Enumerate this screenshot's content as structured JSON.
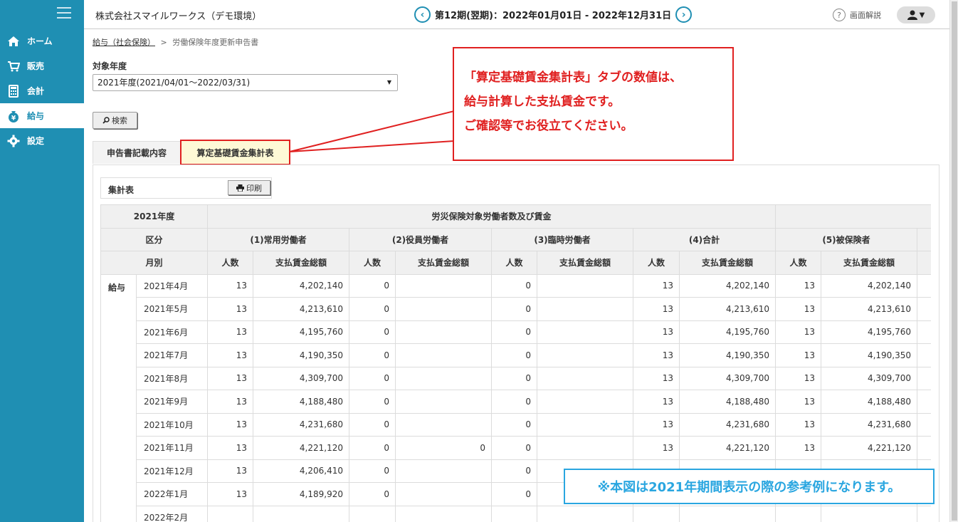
{
  "sidebar": {
    "items": [
      {
        "label": "ホーム",
        "icon": "home-icon"
      },
      {
        "label": "販売",
        "icon": "cart-icon"
      },
      {
        "label": "会計",
        "icon": "calculator-icon"
      },
      {
        "label": "給与",
        "icon": "money-bag-icon",
        "active": true
      },
      {
        "label": "設定",
        "icon": "gear-icon"
      }
    ]
  },
  "header": {
    "company": "株式会社スマイルワークス（デモ環境）",
    "period": "第12期(翌期)：2022年01月01日 - 2022年12月31日",
    "help_label": "画面解説"
  },
  "breadcrumb": {
    "parent": "給与（社会保険）",
    "separator": ">",
    "current": "労働保険年度更新申告書"
  },
  "form": {
    "year_label": "対象年度",
    "year_value": "2021年度(2021/04/01～2022/03/31)",
    "search_label": "検索"
  },
  "tabs": [
    {
      "label": "申告書記載内容"
    },
    {
      "label": "算定基礎賃金集計表",
      "active": true
    }
  ],
  "summary": {
    "title": "集計表",
    "print_label": "印刷"
  },
  "table": {
    "year": "2021年度",
    "group_header": "労災保険対象労働者数及び賃金",
    "kubun": "区分",
    "month_label": "月別",
    "columns": [
      "(1)常用労働者",
      "(2)役員労働者",
      "(3)臨時労働者",
      "(4)合計",
      "(5)被保険者"
    ],
    "sub_count": "人数",
    "sub_amount": "支払賃金総額",
    "category": "給与",
    "rows": [
      {
        "month": "2021年4月",
        "c1": "13",
        "a1": "4,202,140",
        "c2": "0",
        "a2": "",
        "c3": "0",
        "a3": "",
        "c4": "13",
        "a4": "4,202,140",
        "c5": "13",
        "a5": "4,202,140"
      },
      {
        "month": "2021年5月",
        "c1": "13",
        "a1": "4,213,610",
        "c2": "0",
        "a2": "",
        "c3": "0",
        "a3": "",
        "c4": "13",
        "a4": "4,213,610",
        "c5": "13",
        "a5": "4,213,610"
      },
      {
        "month": "2021年6月",
        "c1": "13",
        "a1": "4,195,760",
        "c2": "0",
        "a2": "",
        "c3": "0",
        "a3": "",
        "c4": "13",
        "a4": "4,195,760",
        "c5": "13",
        "a5": "4,195,760"
      },
      {
        "month": "2021年7月",
        "c1": "13",
        "a1": "4,190,350",
        "c2": "0",
        "a2": "",
        "c3": "0",
        "a3": "",
        "c4": "13",
        "a4": "4,190,350",
        "c5": "13",
        "a5": "4,190,350"
      },
      {
        "month": "2021年8月",
        "c1": "13",
        "a1": "4,309,700",
        "c2": "0",
        "a2": "",
        "c3": "0",
        "a3": "",
        "c4": "13",
        "a4": "4,309,700",
        "c5": "13",
        "a5": "4,309,700"
      },
      {
        "month": "2021年9月",
        "c1": "13",
        "a1": "4,188,480",
        "c2": "0",
        "a2": "",
        "c3": "0",
        "a3": "",
        "c4": "13",
        "a4": "4,188,480",
        "c5": "13",
        "a5": "4,188,480"
      },
      {
        "month": "2021年10月",
        "c1": "13",
        "a1": "4,231,680",
        "c2": "0",
        "a2": "",
        "c3": "0",
        "a3": "",
        "c4": "13",
        "a4": "4,231,680",
        "c5": "13",
        "a5": "4,231,680"
      },
      {
        "month": "2021年11月",
        "c1": "13",
        "a1": "4,221,120",
        "c2": "0",
        "a2": "0",
        "c3": "0",
        "a3": "",
        "c4": "13",
        "a4": "4,221,120",
        "c5": "13",
        "a5": "4,221,120"
      },
      {
        "month": "2021年12月",
        "c1": "13",
        "a1": "4,206,410",
        "c2": "0",
        "a2": "",
        "c3": "0",
        "a3": "",
        "c4": "",
        "a4": "",
        "c5": "",
        "a5": ""
      },
      {
        "month": "2022年1月",
        "c1": "13",
        "a1": "4,189,920",
        "c2": "0",
        "a2": "",
        "c3": "0",
        "a3": "",
        "c4": "",
        "a4": "",
        "c5": "",
        "a5": ""
      },
      {
        "month": "2022年2月",
        "c1": "",
        "a1": "",
        "c2": "",
        "a2": "",
        "c3": "",
        "a3": "",
        "c4": "",
        "a4": "",
        "c5": "",
        "a5": ""
      }
    ]
  },
  "callout": {
    "line1": "「算定基礎賃金集計表」タブの数値は、",
    "line2": "給与計算した支払賃金です。",
    "line3": "ご確認等でお役立てください。"
  },
  "note": "※本図は2021年期間表示の際の参考例になります。",
  "colors": {
    "sidebar": "#1f8fb3",
    "callout": "#e02020",
    "note": "#2aa6e0",
    "active_tab": "#fef9d6"
  }
}
